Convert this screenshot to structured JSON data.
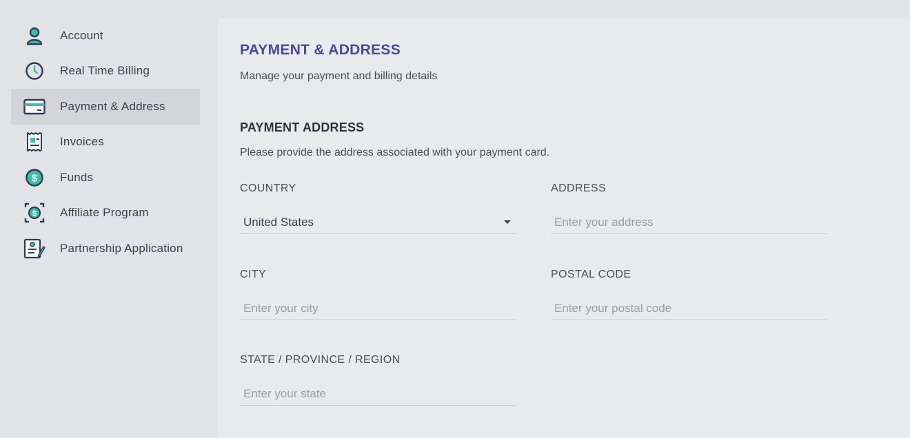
{
  "sidebar": {
    "items": [
      {
        "label": "Account",
        "icon": "user-icon"
      },
      {
        "label": "Real Time Billing",
        "icon": "clock-icon"
      },
      {
        "label": "Payment & Address",
        "icon": "credit-card-icon",
        "active": true
      },
      {
        "label": "Invoices",
        "icon": "receipt-icon"
      },
      {
        "label": "Funds",
        "icon": "dollar-coin-icon"
      },
      {
        "label": "Affiliate Program",
        "icon": "affiliate-icon"
      },
      {
        "label": "Partnership Application",
        "icon": "application-form-icon"
      }
    ]
  },
  "main": {
    "title": "PAYMENT & ADDRESS",
    "subtitle": "Manage your payment and billing details",
    "section": {
      "title": "PAYMENT ADDRESS",
      "description": "Please provide the address associated with your payment card."
    },
    "fields": {
      "country": {
        "label": "COUNTRY",
        "value": "United States"
      },
      "address": {
        "label": "ADDRESS",
        "placeholder": "Enter your address"
      },
      "city": {
        "label": "CITY",
        "placeholder": "Enter your city"
      },
      "postal_code": {
        "label": "POSTAL CODE",
        "placeholder": "Enter your postal code"
      },
      "state": {
        "label": "STATE / PROVINCE / REGION",
        "placeholder": "Enter your state"
      }
    }
  },
  "colors": {
    "accent": "#4a4a9c",
    "icon_teal": "#3dbfa6",
    "icon_navy": "#2f3a5a",
    "background": "#e2e3e6",
    "panel": "#e9eaec",
    "active_item": "#d3d4d8"
  }
}
